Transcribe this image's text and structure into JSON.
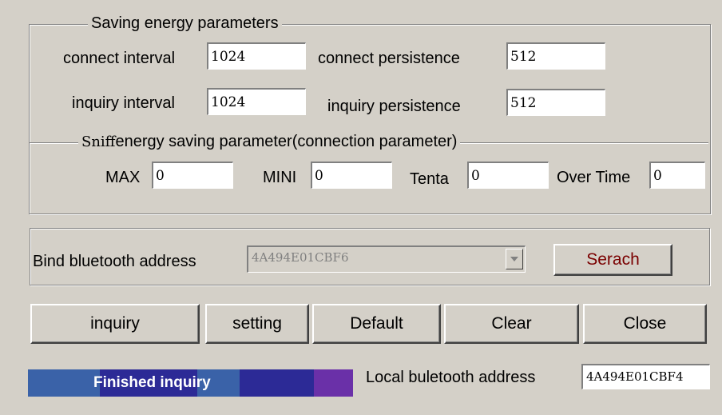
{
  "energy": {
    "title": "Saving energy parameters",
    "connect_interval_label": "connect interval",
    "connect_interval_value": "1024",
    "connect_persistence_label": "connect persistence",
    "connect_persistence_value": "512",
    "inquiry_interval_label": "inquiry interval",
    "inquiry_interval_value": "1024",
    "inquiry_persistence_label": "inquiry persistence",
    "inquiry_persistence_value": "512"
  },
  "sniff": {
    "title_prefix": "Sniff",
    "title_rest": "energy saving parameter(connection parameter)",
    "max_label": "MAX",
    "max_value": "0",
    "mini_label": "MINI",
    "mini_value": "0",
    "tenta_label": "Tenta",
    "tenta_value": "0",
    "over_time_label": "Over Time",
    "over_time_value": "0"
  },
  "bind": {
    "label": "Bind bluetooth address",
    "selected_address": "4A494E01CBF6",
    "search_button": "Serach"
  },
  "actions": {
    "inquiry": "inquiry",
    "setting": "setting",
    "default": "Default",
    "clear": "Clear",
    "close": "Close"
  },
  "status": {
    "progress_text": "Finished inquiry",
    "progress_fraction": 1.0,
    "local_address_label": "Local buletooth address",
    "local_address_value": "4A494E01CBF4"
  },
  "icons": {
    "combo_arrow": "chevron-down-icon"
  },
  "colors": {
    "background": "#d4d0c8",
    "progress_blue": "#3a62a8",
    "progress_navy": "#2c2a96",
    "progress_purple": "#6a30a8",
    "progress_text": "#ffffff"
  }
}
